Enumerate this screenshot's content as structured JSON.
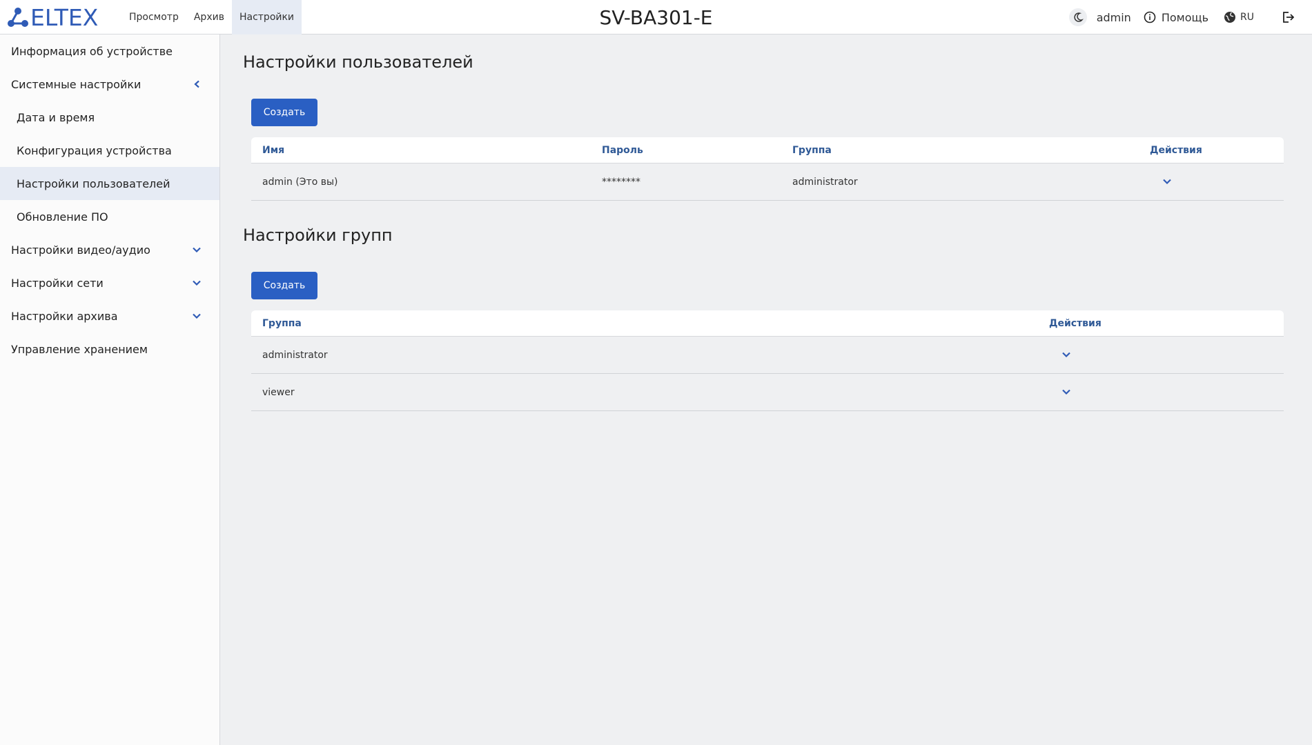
{
  "header": {
    "logo_text": "ELTEX",
    "nav": [
      {
        "label": "Просмотр"
      },
      {
        "label": "Архив"
      },
      {
        "label": "Настройки",
        "active": true
      }
    ],
    "title": "SV-BA301-E",
    "user": "admin",
    "help": "Помощь",
    "lang": "RU"
  },
  "sidebar": {
    "items": [
      {
        "label": "Информация об устройстве"
      },
      {
        "label": "Системные настройки",
        "icon": "chevron-left-icon"
      },
      {
        "label": "Дата и время"
      },
      {
        "label": "Конфигурация устройства"
      },
      {
        "label": "Настройки пользователей",
        "active": true
      },
      {
        "label": "Обновление ПО"
      },
      {
        "label": "Настройки видео/аудио",
        "icon": "chevron-down-icon"
      },
      {
        "label": "Настройки сети",
        "icon": "chevron-down-icon"
      },
      {
        "label": "Настройки архива",
        "icon": "chevron-down-icon"
      },
      {
        "label": "Управление хранением"
      }
    ]
  },
  "users": {
    "title": "Настройки пользователей",
    "create_label": "Создать",
    "columns": [
      "Имя",
      "Пароль",
      "Группа",
      "Действия"
    ],
    "rows": [
      {
        "name": "admin (Это вы)",
        "password": "********",
        "group": "administrator"
      }
    ]
  },
  "groups": {
    "title": "Настройки групп",
    "create_label": "Создать",
    "columns": [
      "Группа",
      "Действия"
    ],
    "rows": [
      {
        "group": "administrator"
      },
      {
        "group": "viewer"
      }
    ]
  },
  "colors": {
    "accent": "#2a5fc3",
    "brand": "#2f5bb6",
    "header_text": "#2f5996"
  }
}
